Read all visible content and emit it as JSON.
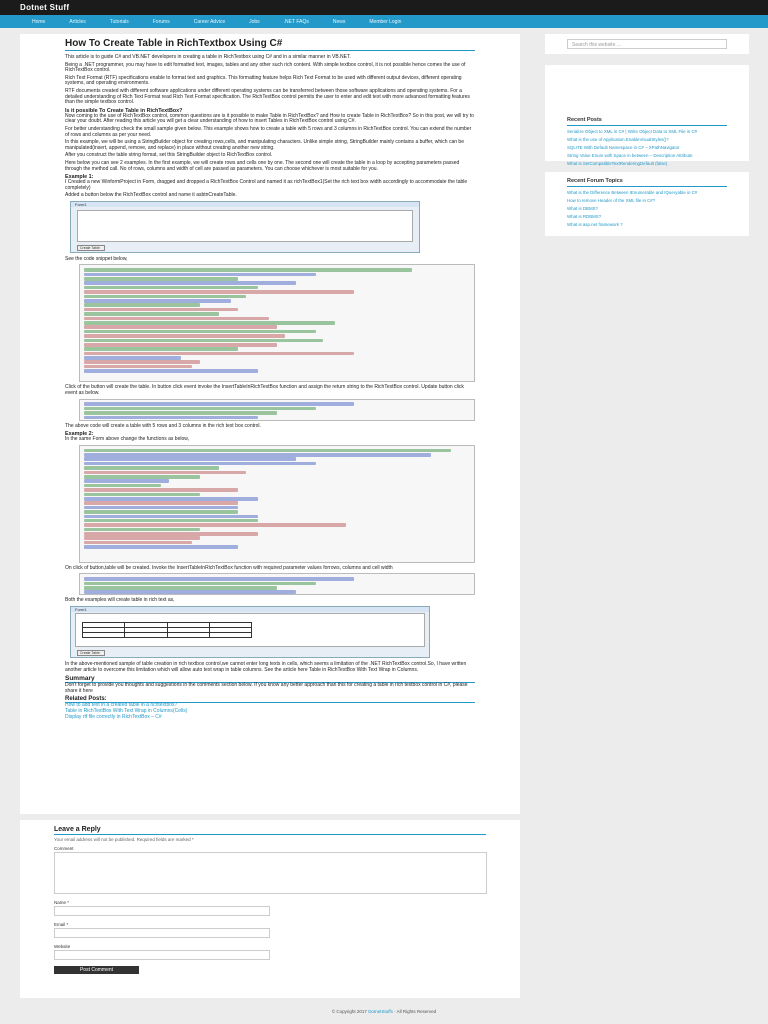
{
  "site": {
    "brand": "Dotnet Stuff"
  },
  "nav": [
    "Home",
    "Articles",
    "Tutorials",
    "Forums",
    "Career Advice",
    "Jobs",
    ".NET FAQs",
    "News",
    "Member Login"
  ],
  "article": {
    "title": "How To Create Table in RichTextbox Using C#",
    "p1": "This article is to guide C#  and VB.NET developers in creating a table in RichTextbox using C# and in a similar manner in VB.NET.",
    "p2": "Being a .NET programmer, you may have to edit formatted text, images, tables and any other such rich content. With simple textbox control, it is not possible hence comes the use of RichTextBox control.",
    "p3": "Rich Text Format (RTF) specifications enable to format text and graphics. This formatting feature helps Rich Text Format to be used with different output devices, different operating systems, and operating environments.",
    "p4": "RTF documents created with different software applications under different operating systems can be transferred between those software applications and operating systems. For a detailed understanding of Rich Text Format read Rich Text Format specification. The RichTextBox control permits the user to enter and edit text with more advanced formatting features than the simple textbox control.",
    "q1": "Is it possible To Create Table in RichTextBox?",
    "p5": "Now coming to the use of RichTextBox control, common questions are is it possible to make Table in RichTextBox? and How to create Table in RichTextBox? So in this post, we will try to clear your doubt. After reading this article you will get a clear understanding of how to insert Tables in RichTextBox control using C#.",
    "p6": "For better understanding check the small sample given below. This example shows how to create a table with 5 rows and 3 columns in RichTextBox control. You can extend the number of rows and columns as per your need.",
    "p7": "In this example, we will be using a StringBuilder object for creating rows,cells, and manipulating characters. Unlike simple string, StringBuilder mainly contains a buffer, which can be manipulated(insert, append, remove, and replace) in place without creating another new string.",
    "p8": "After you construct the table string format, set this StringBuilder object to RichTextBox control.",
    "p9": "Here below you can see 2 examples. In the first example, we will create rows and cells one by one. The second one will create the table in a loop by accepting parameters passed through the method call. No of rows, columns and width of cell are passed as parameters. You can choose whichever is most suitable for you.",
    "ex1": "Example 1:",
    "p10": "I Created a new WinformProject in Form, dragged and dropped a RichTextBox Control and named it as richTextBox1(Set the rich text box width accordingly to accommodate the table completely)",
    "p11": "Added a button below the RichTextBox control and name it asbtnCreateTable.",
    "form1_title": "Form1",
    "form_button": "Create Table",
    "p12": "See the code snippet below,",
    "p13": "Click of the button will create the table. In button click event invoke the InsertTableInRichTextBox function and assign the return string to the RichTextBox control. Update button click event as below.",
    "p14": "The above code will create a table with 5 rows and 3 columns in the rich text box control.",
    "ex2": "Example 2:",
    "p15": "In the same Form above change the functions as below,",
    "p16": "On click of button,table will be created. Invoke the InsertTableInRichTextBox function with required parameter values forrows, columns and cell width",
    "p17": "Both the examples will create table in rich text as,",
    "form2_title": "Form1",
    "p18": "In the above-mentioned sample of table creation in rich textbox control,we cannot enter long texts in cells, which seems a limitation of the .NET RichTextBox control.So, I have written another article to overcome this limitation which will allow auto text wrap in table columns. See the article here Table in RichTextBox With Text Wrap in Columns.",
    "summary_title": "Summary",
    "p19": "Don't forget to provide you thoughts and suggestions in the comments section below. If you know any better approach than this for creating a table in rich textbox control in C#, please share it here",
    "related_title": "Related Posts:",
    "related": [
      "How to add text in a created table in a richtextbox?",
      "Table in RichTextBox With Text Wrap in Columns(Cells)",
      "Display rtf file correctly in RichTextBox – C#"
    ]
  },
  "sidebar": {
    "search_placeholder": "Search this website ...",
    "recent_posts_title": "Recent Posts",
    "recent_posts": [
      "Serialize Object to XML in C# | Write Object Data to XML File in C#",
      "What is the use of Application.EnableVisualStyles()?",
      "SQLITE With Default Namespace in C# – XPathNavigator",
      "String Value Enum with Space in between – Description Attribute",
      "What is SetCompatibleTextRenderingDefault (false)"
    ],
    "recent_topics_title": "Recent Forum Topics",
    "recent_topics": [
      "What is the Difference Between IEnumerable and IQueryable in C#",
      "How to remove Header of the XML file in C#?",
      "What is DBMS?",
      "What is RDBMS?",
      "What is asp.net framework ?"
    ]
  },
  "comments": {
    "title": "Leave a Reply",
    "note": "Your email address will not be published. Required fields are marked *",
    "comment_label": "Comment",
    "name_label": "Name *",
    "email_label": "Email *",
    "website_label": "Website",
    "post_button": "Post Comment"
  },
  "footer": {
    "prefix": "© Copyright 2017 ",
    "link": "DotnetStuffs",
    "suffix": " · All Rights Reserved"
  }
}
